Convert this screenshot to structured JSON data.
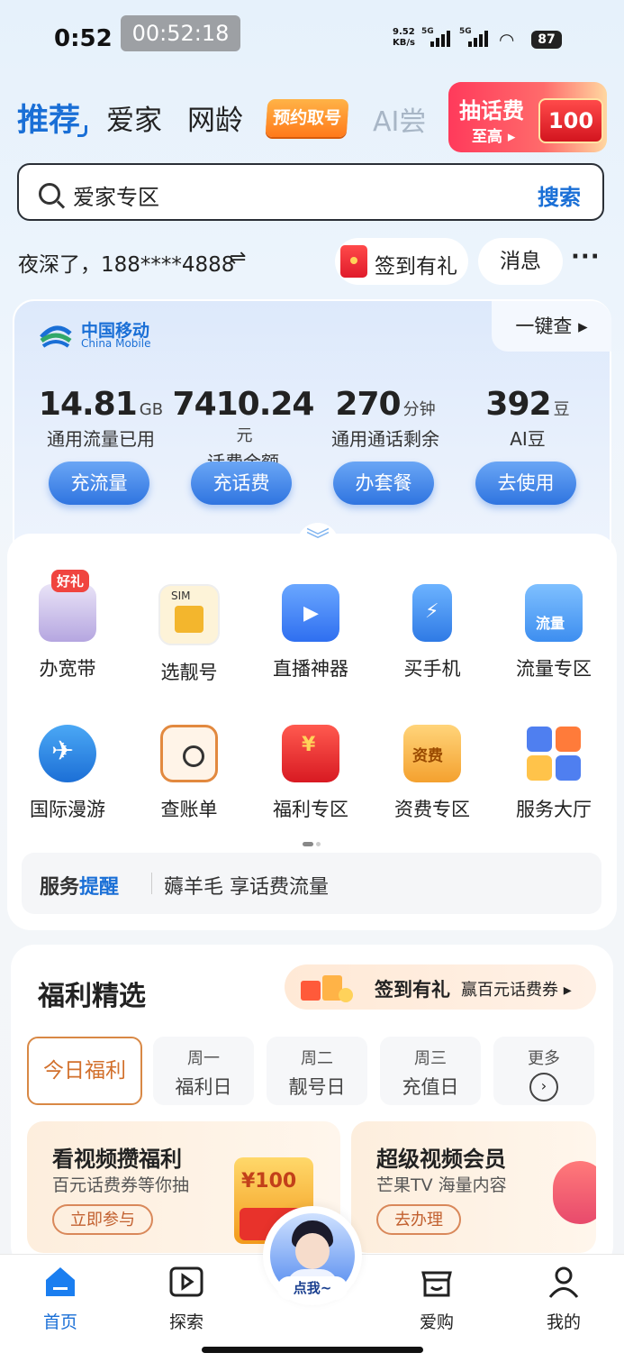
{
  "status_bar": {
    "time": "0:52",
    "timer": "00:52:18",
    "speed_value": "9.52",
    "speed_unit": "KB/s",
    "signal_1": "5G",
    "signal_2": "5G",
    "battery": "87"
  },
  "top_tabs": {
    "recommend": "推荐",
    "home": "爱家",
    "age": "网龄",
    "reserve": "预约取号",
    "ai": "AI尝"
  },
  "promo": {
    "title": "抽话费",
    "subtitle": "至高 ▸",
    "amount": "100元"
  },
  "search": {
    "value": "爱家专区",
    "button": "搜索"
  },
  "greeting": {
    "text": "夜深了，188****4888",
    "swap": "⇌"
  },
  "actions": {
    "checkin": "签到有礼",
    "messages": "消息",
    "more": "···"
  },
  "account": {
    "brand_cn": "中国移动",
    "brand_en": "China Mobile",
    "one_key": "一键查 ▸",
    "stats": [
      {
        "value": "14.81",
        "unit": "GB",
        "label": "通用流量已用",
        "button": "充流量"
      },
      {
        "value": "7410.24",
        "unit": "元",
        "label": "话费余额",
        "button": "充话费"
      },
      {
        "value": "270",
        "unit": "分钟",
        "label": "通用通话剩余",
        "button": "办套餐"
      },
      {
        "value": "392",
        "unit": "豆",
        "label": "AI豆",
        "button": "去使用"
      }
    ]
  },
  "services": [
    {
      "label": "办宽带",
      "tag": "好礼"
    },
    {
      "label": "选靓号",
      "tag": "SIM"
    },
    {
      "label": "直播神器"
    },
    {
      "label": "买手机"
    },
    {
      "label": "流量专区",
      "tag": "流量"
    },
    {
      "label": "国际漫游"
    },
    {
      "label": "查账单"
    },
    {
      "label": "福利专区",
      "tag": "¥"
    },
    {
      "label": "资费专区",
      "tag": "资费"
    },
    {
      "label": "服务大厅"
    }
  ],
  "reminder": {
    "title_a": "服务",
    "title_b": "提醒",
    "text": "薅羊毛 享话费流量"
  },
  "welfare": {
    "title": "福利精选",
    "promo_title": "签到有礼",
    "promo_sub": "赢百元话费券 ▸",
    "days": [
      {
        "label": "今日福利"
      },
      {
        "top": "周一",
        "bottom": "福利日"
      },
      {
        "top": "周二",
        "bottom": "靓号日"
      },
      {
        "top": "周三",
        "bottom": "充值日"
      },
      {
        "top": "更多",
        "bottom": "›"
      }
    ],
    "cards": [
      {
        "title": "看视频攒福利",
        "sub": "百元话费券等你抽",
        "button": "立即参与",
        "badge": "¥100"
      },
      {
        "title": "超级视频会员",
        "sub": "芒果TV 海量内容",
        "button": "去办理"
      }
    ]
  },
  "nav": {
    "home": "首页",
    "explore": "探索",
    "assistant": "点我~",
    "shop": "爱购",
    "me": "我的"
  },
  "colors": {
    "accent": "#1a6fd6",
    "orange": "#ff7a1a",
    "red": "#e01b2b"
  }
}
